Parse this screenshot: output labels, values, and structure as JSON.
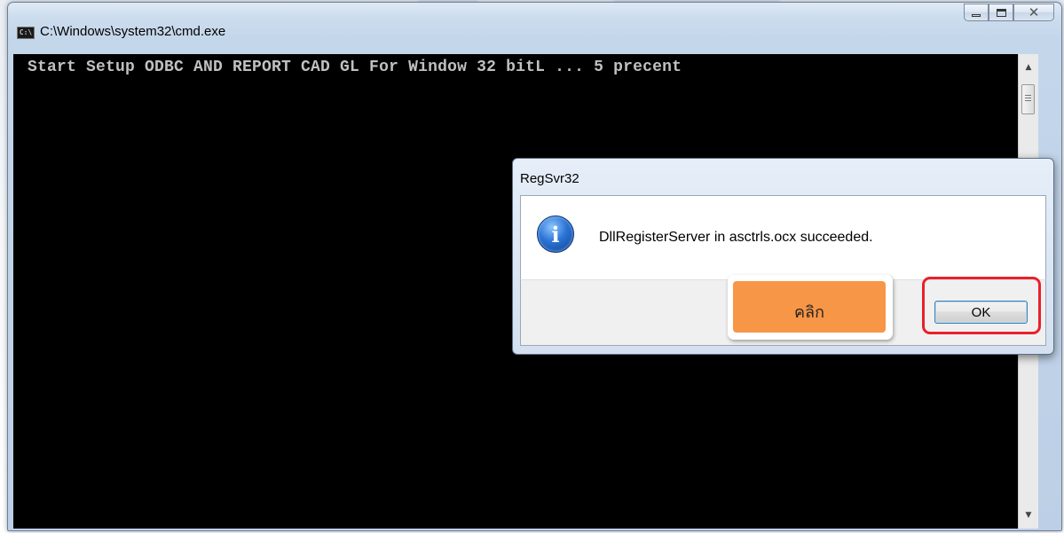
{
  "window": {
    "title": "C:\\Windows\\system32\\cmd.exe",
    "icon": "cmd-icon",
    "icon_text": "C:\\",
    "controls": {
      "minimize": "minimize-icon",
      "maximize": "maximize-icon",
      "close": "close-icon",
      "close_glyph": "✕"
    }
  },
  "console": {
    "line": "Start Setup ODBC AND REPORT CAD GL For Window 32 bitL ... 5 precent"
  },
  "dialog": {
    "title": "RegSvr32",
    "icon": "info-icon",
    "icon_glyph": "i",
    "message": "DllRegisterServer in asctrls.ocx succeeded.",
    "ok_label": "OK"
  },
  "annotation": {
    "callout_text": "คลิก",
    "callout_color": "#f79646",
    "highlight_color": "#e8212b"
  }
}
